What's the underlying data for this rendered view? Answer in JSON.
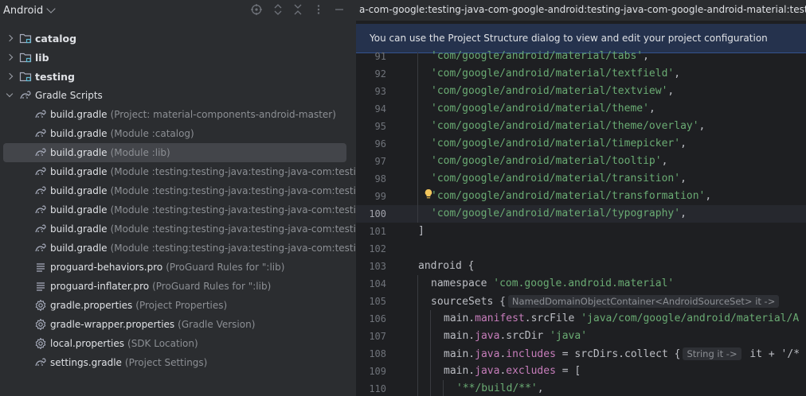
{
  "project": {
    "view_selector": "Android",
    "header_icons": [
      "target-icon",
      "expand-collapse-icon",
      "collapse-all-icon",
      "more-icon",
      "hide-icon"
    ],
    "tree": [
      {
        "indent": 0,
        "arrow": "right",
        "icon": "module-folder-icon",
        "name": "catalog",
        "hint": "",
        "bold": true
      },
      {
        "indent": 0,
        "arrow": "right",
        "icon": "module-folder-icon",
        "name": "lib",
        "hint": "",
        "bold": true
      },
      {
        "indent": 0,
        "arrow": "right",
        "icon": "module-folder-icon",
        "name": "testing",
        "hint": "",
        "bold": true
      },
      {
        "indent": 0,
        "arrow": "down",
        "icon": "gradle-icon",
        "name": "Gradle Scripts",
        "hint": "",
        "bold": false
      },
      {
        "indent": 1,
        "arrow": "",
        "icon": "gradle-icon",
        "name": "build.gradle",
        "hint": "(Project: material-components-android-master)",
        "bold": false
      },
      {
        "indent": 1,
        "arrow": "",
        "icon": "gradle-icon",
        "name": "build.gradle",
        "hint": "(Module :catalog)",
        "bold": false
      },
      {
        "indent": 1,
        "arrow": "",
        "icon": "gradle-icon",
        "name": "build.gradle",
        "hint": "(Module :lib)",
        "bold": false,
        "selected": true
      },
      {
        "indent": 1,
        "arrow": "",
        "icon": "gradle-icon",
        "name": "build.gradle",
        "hint": "(Module :testing:testing-java:testing-java-com:testing-java-",
        "bold": false
      },
      {
        "indent": 1,
        "arrow": "",
        "icon": "gradle-icon",
        "name": "build.gradle",
        "hint": "(Module :testing:testing-java:testing-java-com:testing-java-",
        "bold": false
      },
      {
        "indent": 1,
        "arrow": "",
        "icon": "gradle-icon",
        "name": "build.gradle",
        "hint": "(Module :testing:testing-java:testing-java-com:testing-java-",
        "bold": false
      },
      {
        "indent": 1,
        "arrow": "",
        "icon": "gradle-icon",
        "name": "build.gradle",
        "hint": "(Module :testing:testing-java:testing-java-com:testing-java-",
        "bold": false
      },
      {
        "indent": 1,
        "arrow": "",
        "icon": "gradle-icon",
        "name": "build.gradle",
        "hint": "(Module :testing:testing-java:testing-java-com:testing-java-",
        "bold": false
      },
      {
        "indent": 1,
        "arrow": "",
        "icon": "text-file-icon",
        "name": "proguard-behaviors.pro",
        "hint": "(ProGuard Rules for \":lib)",
        "bold": false
      },
      {
        "indent": 1,
        "arrow": "",
        "icon": "text-file-icon",
        "name": "proguard-inflater.pro",
        "hint": "(ProGuard Rules for \":lib)",
        "bold": false
      },
      {
        "indent": 1,
        "arrow": "",
        "icon": "settings-gear-icon",
        "name": "gradle.properties",
        "hint": "(Project Properties)",
        "bold": false
      },
      {
        "indent": 1,
        "arrow": "",
        "icon": "settings-gear-icon",
        "name": "gradle-wrapper.properties",
        "hint": "(Gradle Version)",
        "bold": false
      },
      {
        "indent": 1,
        "arrow": "",
        "icon": "settings-gear-icon",
        "name": "local.properties",
        "hint": "(SDK Location)",
        "bold": false
      },
      {
        "indent": 1,
        "arrow": "",
        "icon": "gradle-icon",
        "name": "settings.gradle",
        "hint": "(Project Settings)",
        "bold": false
      }
    ]
  },
  "editor": {
    "tab_title": "a-com-google:testing-java-com-google-android:testing-java-com-google-android-material:testing-java-c",
    "notice": "You can use the Project Structure dialog to view and edit your project configuration",
    "current_line": "100",
    "lines": [
      {
        "n": "91",
        "indent": 1,
        "parts": [
          {
            "t": "'com/google/android/material/tabs'",
            "c": "s"
          },
          {
            "t": ",",
            "c": "pl"
          }
        ]
      },
      {
        "n": "92",
        "indent": 1,
        "parts": [
          {
            "t": "'com/google/android/material/textfield'",
            "c": "s"
          },
          {
            "t": ",",
            "c": "pl"
          }
        ]
      },
      {
        "n": "93",
        "indent": 1,
        "parts": [
          {
            "t": "'com/google/android/material/textview'",
            "c": "s"
          },
          {
            "t": ",",
            "c": "pl"
          }
        ]
      },
      {
        "n": "94",
        "indent": 1,
        "parts": [
          {
            "t": "'com/google/android/material/theme'",
            "c": "s"
          },
          {
            "t": ",",
            "c": "pl"
          }
        ]
      },
      {
        "n": "95",
        "indent": 1,
        "parts": [
          {
            "t": "'com/google/android/material/theme/overlay'",
            "c": "s"
          },
          {
            "t": ",",
            "c": "pl"
          }
        ]
      },
      {
        "n": "96",
        "indent": 1,
        "parts": [
          {
            "t": "'com/google/android/material/timepicker'",
            "c": "s"
          },
          {
            "t": ",",
            "c": "pl"
          }
        ]
      },
      {
        "n": "97",
        "indent": 1,
        "parts": [
          {
            "t": "'com/google/android/material/tooltip'",
            "c": "s"
          },
          {
            "t": ",",
            "c": "pl"
          }
        ]
      },
      {
        "n": "98",
        "indent": 1,
        "parts": [
          {
            "t": "'com/google/android/material/transition'",
            "c": "s"
          },
          {
            "t": ",",
            "c": "pl"
          }
        ]
      },
      {
        "n": "99",
        "indent": 1,
        "parts": [
          {
            "t": "'com/google/android/material/transformation'",
            "c": "s"
          },
          {
            "t": ",",
            "c": "pl"
          }
        ]
      },
      {
        "n": "100",
        "indent": 1,
        "parts": [
          {
            "t": "'com/google/android/material/typography'",
            "c": "s"
          },
          {
            "t": ",",
            "c": "pl"
          }
        ]
      },
      {
        "n": "101",
        "indent": 0,
        "parts": [
          {
            "t": "]",
            "c": "pl"
          }
        ]
      },
      {
        "n": "102",
        "indent": 0,
        "parts": []
      },
      {
        "n": "103",
        "indent": 0,
        "parts": [
          {
            "t": "android {",
            "c": "pl"
          }
        ]
      },
      {
        "n": "104",
        "indent": 1,
        "parts": [
          {
            "t": "namespace ",
            "c": "pl"
          },
          {
            "t": "'com.google.android.material'",
            "c": "s"
          }
        ]
      },
      {
        "n": "105",
        "indent": 1,
        "parts": [
          {
            "t": "sourceSets {",
            "c": "pl"
          },
          {
            "inlay": "NamedDomainObjectContainer<AndroidSourceSet> it ->"
          }
        ]
      },
      {
        "n": "106",
        "indent": 2,
        "parts": [
          {
            "t": "main.",
            "c": "pl"
          },
          {
            "t": "manifest",
            "c": "f"
          },
          {
            "t": ".srcFile ",
            "c": "pl"
          },
          {
            "t": "'java/com/google/android/material/A",
            "c": "s"
          }
        ]
      },
      {
        "n": "107",
        "indent": 2,
        "parts": [
          {
            "t": "main.",
            "c": "pl"
          },
          {
            "t": "java",
            "c": "f"
          },
          {
            "t": ".srcDir ",
            "c": "pl"
          },
          {
            "t": "'java'",
            "c": "s"
          }
        ]
      },
      {
        "n": "108",
        "indent": 2,
        "parts": [
          {
            "t": "main.",
            "c": "pl"
          },
          {
            "t": "java",
            "c": "f"
          },
          {
            "t": ".",
            "c": "pl"
          },
          {
            "t": "includes",
            "c": "f"
          },
          {
            "t": " = srcDirs.collect {",
            "c": "pl"
          },
          {
            "inlay": "String it ->"
          },
          {
            "t": " it + '/*",
            "c": "pl"
          }
        ]
      },
      {
        "n": "109",
        "indent": 2,
        "parts": [
          {
            "t": "main.",
            "c": "pl"
          },
          {
            "t": "java",
            "c": "f"
          },
          {
            "t": ".",
            "c": "pl"
          },
          {
            "t": "excludes",
            "c": "f"
          },
          {
            "t": " = [",
            "c": "pl"
          }
        ]
      },
      {
        "n": "110",
        "indent": 3,
        "parts": [
          {
            "t": "'**/build/**'",
            "c": "s"
          },
          {
            "t": ",",
            "c": "pl"
          }
        ]
      }
    ]
  },
  "colors": {
    "panel_bg": "#2b2d30",
    "editor_bg": "#1e1f22",
    "selection": "#43454a",
    "string": "#6aab73",
    "field": "#c77dbb",
    "notice_bg": "#25324d"
  }
}
